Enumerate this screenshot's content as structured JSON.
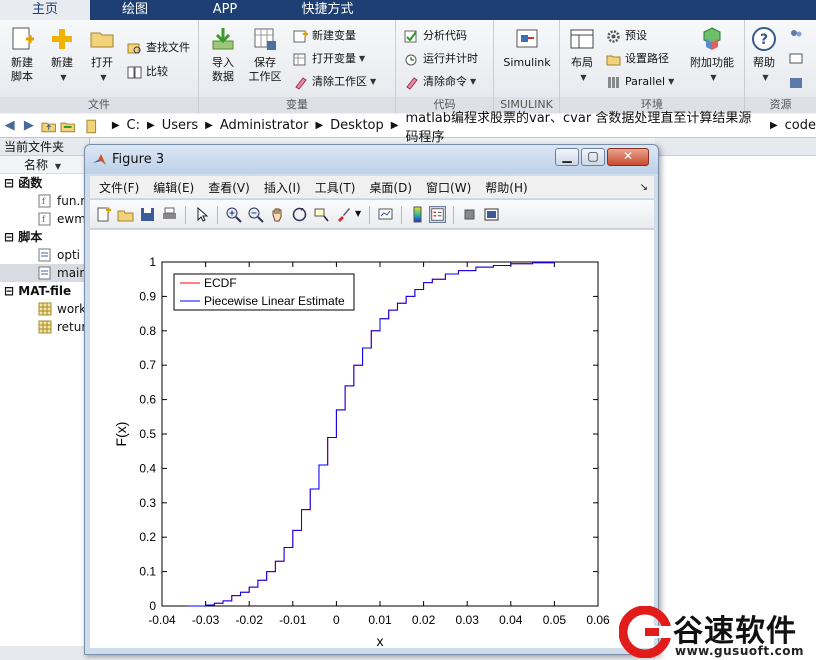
{
  "tabs": [
    {
      "label": "主页",
      "active": true
    },
    {
      "label": "绘图",
      "active": false
    },
    {
      "label": "APP",
      "active": false
    },
    {
      "label": "快捷方式",
      "active": false
    }
  ],
  "ribbon": {
    "file": {
      "title": "文件",
      "new_script": "新建\n脚本",
      "new": "新建",
      "open": "打开",
      "find_files": "查找文件",
      "compare": "比较"
    },
    "variable": {
      "title": "变量",
      "import": "导入\n数据",
      "save_workspace": "保存\n工作区",
      "new_variable": "新建变量",
      "open_variable": "打开变量",
      "clear_workspace": "清除工作区"
    },
    "code": {
      "title": "代码",
      "analyze": "分析代码",
      "run_time": "运行并计时",
      "clear_commands": "清除命令"
    },
    "simulink": {
      "title": "SIMULINK",
      "label": "Simulink"
    },
    "environment": {
      "title": "环境",
      "layout": "布局",
      "preferences": "预设",
      "set_path": "设置路径",
      "parallel": "Parallel",
      "addons": "附加功能"
    },
    "resources": {
      "title": "资源",
      "help": "帮助"
    }
  },
  "address": {
    "path": [
      "C:",
      "Users",
      "Administrator",
      "Desktop",
      "matlab编程求股票的var、cvar 含数据处理直至计算结果源码程序",
      "code"
    ]
  },
  "left_panel": {
    "title": "当前文件夹",
    "col_name": "名称",
    "groups": [
      {
        "label": "函数",
        "items": [
          "fun.m",
          "ewm"
        ]
      },
      {
        "label": "脚本",
        "items": [
          "opti",
          "main"
        ]
      },
      {
        "label": "MAT-file",
        "items": [
          "work",
          "retur"
        ]
      }
    ]
  },
  "figure": {
    "title": "Figure 3",
    "menu": [
      "文件(F)",
      "编辑(E)",
      "查看(V)",
      "插入(I)",
      "工具(T)",
      "桌面(D)",
      "窗口(W)",
      "帮助(H)"
    ],
    "menu_arrow": "↘"
  },
  "chart_data": {
    "type": "line",
    "xlabel": "x",
    "ylabel": "F(x)",
    "xlim": [
      -0.04,
      0.06
    ],
    "ylim": [
      0,
      1
    ],
    "xticks": [
      "-0.04",
      "-0.03",
      "-0.02",
      "-0.01",
      "0",
      "0.01",
      "0.02",
      "0.03",
      "0.04",
      "0.05",
      "0.06"
    ],
    "yticks": [
      "0",
      "0.1",
      "0.2",
      "0.3",
      "0.4",
      "0.5",
      "0.6",
      "0.7",
      "0.8",
      "0.9",
      "1"
    ],
    "legend_position": "top-left",
    "series": [
      {
        "name": "ECDF",
        "color": "#ff0000",
        "x": [
          -0.034,
          -0.03,
          -0.028,
          -0.026,
          -0.024,
          -0.022,
          -0.02,
          -0.018,
          -0.016,
          -0.014,
          -0.012,
          -0.01,
          -0.008,
          -0.006,
          -0.004,
          -0.002,
          0,
          0.002,
          0.004,
          0.006,
          0.008,
          0.01,
          0.012,
          0.014,
          0.016,
          0.018,
          0.02,
          0.022,
          0.025,
          0.028,
          0.032,
          0.036,
          0.04,
          0.045,
          0.05
        ],
        "y": [
          0,
          0.003,
          0.008,
          0.015,
          0.03,
          0.04,
          0.055,
          0.075,
          0.1,
          0.13,
          0.17,
          0.22,
          0.28,
          0.34,
          0.41,
          0.49,
          0.57,
          0.64,
          0.7,
          0.75,
          0.8,
          0.835,
          0.86,
          0.88,
          0.9,
          0.92,
          0.94,
          0.95,
          0.965,
          0.975,
          0.985,
          0.99,
          0.995,
          0.998,
          1
        ]
      },
      {
        "name": "Piecewise Linear Estimate",
        "color": "#0000ff",
        "x": [
          -0.034,
          -0.03,
          -0.028,
          -0.026,
          -0.024,
          -0.022,
          -0.02,
          -0.018,
          -0.016,
          -0.014,
          -0.012,
          -0.01,
          -0.008,
          -0.006,
          -0.004,
          -0.002,
          0,
          0.002,
          0.004,
          0.006,
          0.008,
          0.01,
          0.012,
          0.014,
          0.016,
          0.018,
          0.02,
          0.022,
          0.025,
          0.028,
          0.032,
          0.036,
          0.04,
          0.045,
          0.05
        ],
        "y": [
          0,
          0.003,
          0.008,
          0.015,
          0.03,
          0.04,
          0.055,
          0.075,
          0.1,
          0.13,
          0.17,
          0.22,
          0.28,
          0.34,
          0.41,
          0.49,
          0.57,
          0.64,
          0.7,
          0.75,
          0.8,
          0.835,
          0.86,
          0.88,
          0.9,
          0.92,
          0.94,
          0.95,
          0.965,
          0.975,
          0.985,
          0.99,
          0.995,
          0.998,
          1
        ]
      }
    ]
  },
  "watermark": {
    "text": "谷速软件",
    "url": "www.gusuoft.com"
  }
}
